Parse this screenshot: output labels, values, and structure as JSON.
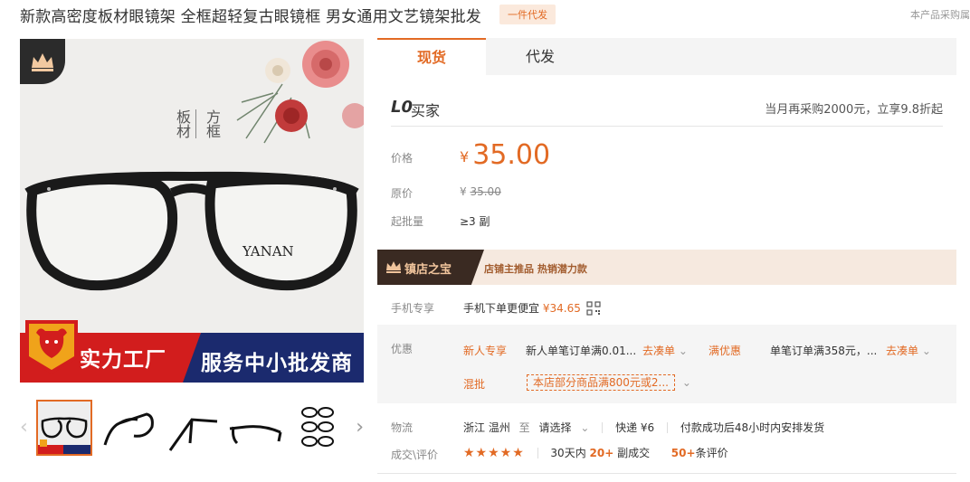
{
  "header": {
    "title": "新款高密度板材眼镜架 全框超轻复古眼镜框 男女通用文艺镜架批发",
    "badge": "一件代发",
    "right_text": "本产品采购属"
  },
  "gallery": {
    "vertical_text_col1": "板材",
    "vertical_text_col2": "方框",
    "brand": "YANAN",
    "banner_left": "实力工厂",
    "banner_right": "服务中小批发商",
    "prev_icon": "chevron-left-icon",
    "next_icon": "chevron-right-icon"
  },
  "tabs": [
    {
      "label": "现货"
    },
    {
      "label": "代发"
    }
  ],
  "buyer": {
    "level": "L0",
    "level_text": "买家",
    "offer": "当月再采购2000元，立享9.8折起"
  },
  "price": {
    "label": "价格",
    "symbol": "¥",
    "value": "35.00",
    "orig_label": "原价",
    "orig_symbol": "¥",
    "orig_value": "35.00",
    "moq_label": "起批量",
    "moq_value": "≥3 副"
  },
  "treasure": {
    "title": "镇店之宝",
    "desc": "店铺主推品  热销潜力款"
  },
  "mobile": {
    "label": "手机专享",
    "text": "手机下单更便宜",
    "price": "¥34.65"
  },
  "promo": {
    "label": "优惠",
    "new_user_tag": "新人专享",
    "new_user_text": "新人单笔订单满0.01...",
    "go_order_1": "去凑单",
    "full_tag": "满优惠",
    "full_text": "单笔订单满358元，...",
    "go_order_2": "去凑单",
    "mix_tag": "混批",
    "mix_text": "本店部分商品满800元或2..."
  },
  "logistics": {
    "label": "物流",
    "from": "浙江 温州",
    "to": "至",
    "select": "请选择",
    "express": "快递 ¥6",
    "ship_note": "付款成功后48小时内安排发货"
  },
  "deal": {
    "label": "成交\\评价",
    "stars": "★★★★★",
    "days_text": "30天内",
    "sold_count": "20+",
    "sold_unit": "副成交",
    "review_count": "50+",
    "review_unit": "条评价"
  },
  "colors": {
    "accent": "#e26a24",
    "banner_red": "#d21d1d",
    "banner_blue": "#1b2a6e",
    "treasure_bg": "#f6e9df"
  }
}
